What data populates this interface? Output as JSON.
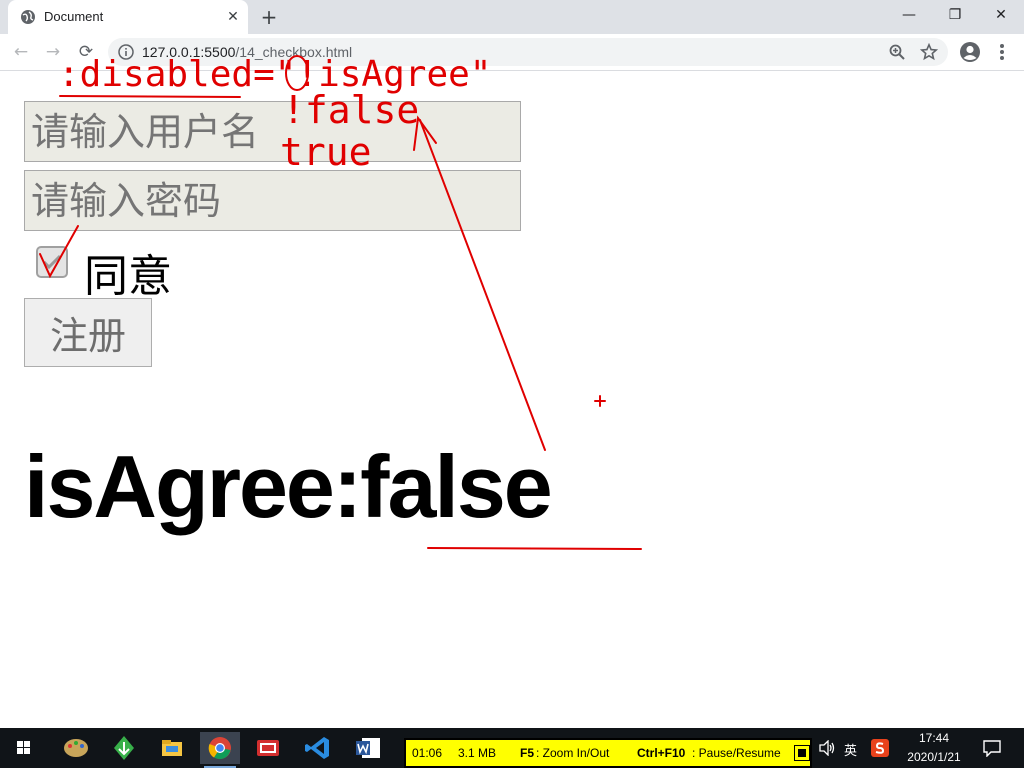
{
  "browser": {
    "tab_title": "Document",
    "tab_close": "✕",
    "new_tab": "+",
    "url_host": "127.0.0.1:5500",
    "url_path": "/14_checkbox.html",
    "window_minimize": "—",
    "window_restore": "❐",
    "window_close": "✕",
    "nav_back": "←",
    "nav_forward": "→",
    "nav_reload": "⟳"
  },
  "form": {
    "username_placeholder": "请输入用户名",
    "password_placeholder": "请输入密码",
    "agree_label": "同意",
    "agree_checked": true,
    "agree_disabled": true,
    "register_label": "注册"
  },
  "status": {
    "key": "isAgree:",
    "value": "false"
  },
  "annotations": {
    "line1": ":disabled=\"!isAgree\"",
    "line2": "!false",
    "line3": "true"
  },
  "recorder": {
    "elapsed": "01:06",
    "size": "3.1 MB",
    "zoom_key": "F5",
    "zoom_label": ": Zoom In/Out",
    "pause_key": "Ctrl+F10",
    "pause_label": ": Pause/Resume"
  },
  "tray": {
    "ime": "英",
    "time": "17:44",
    "date": "2020/1/21"
  },
  "colors": {
    "annotation_ink": "#e00000",
    "recorder_bar": "#ffff00",
    "taskbar": "#101418"
  }
}
